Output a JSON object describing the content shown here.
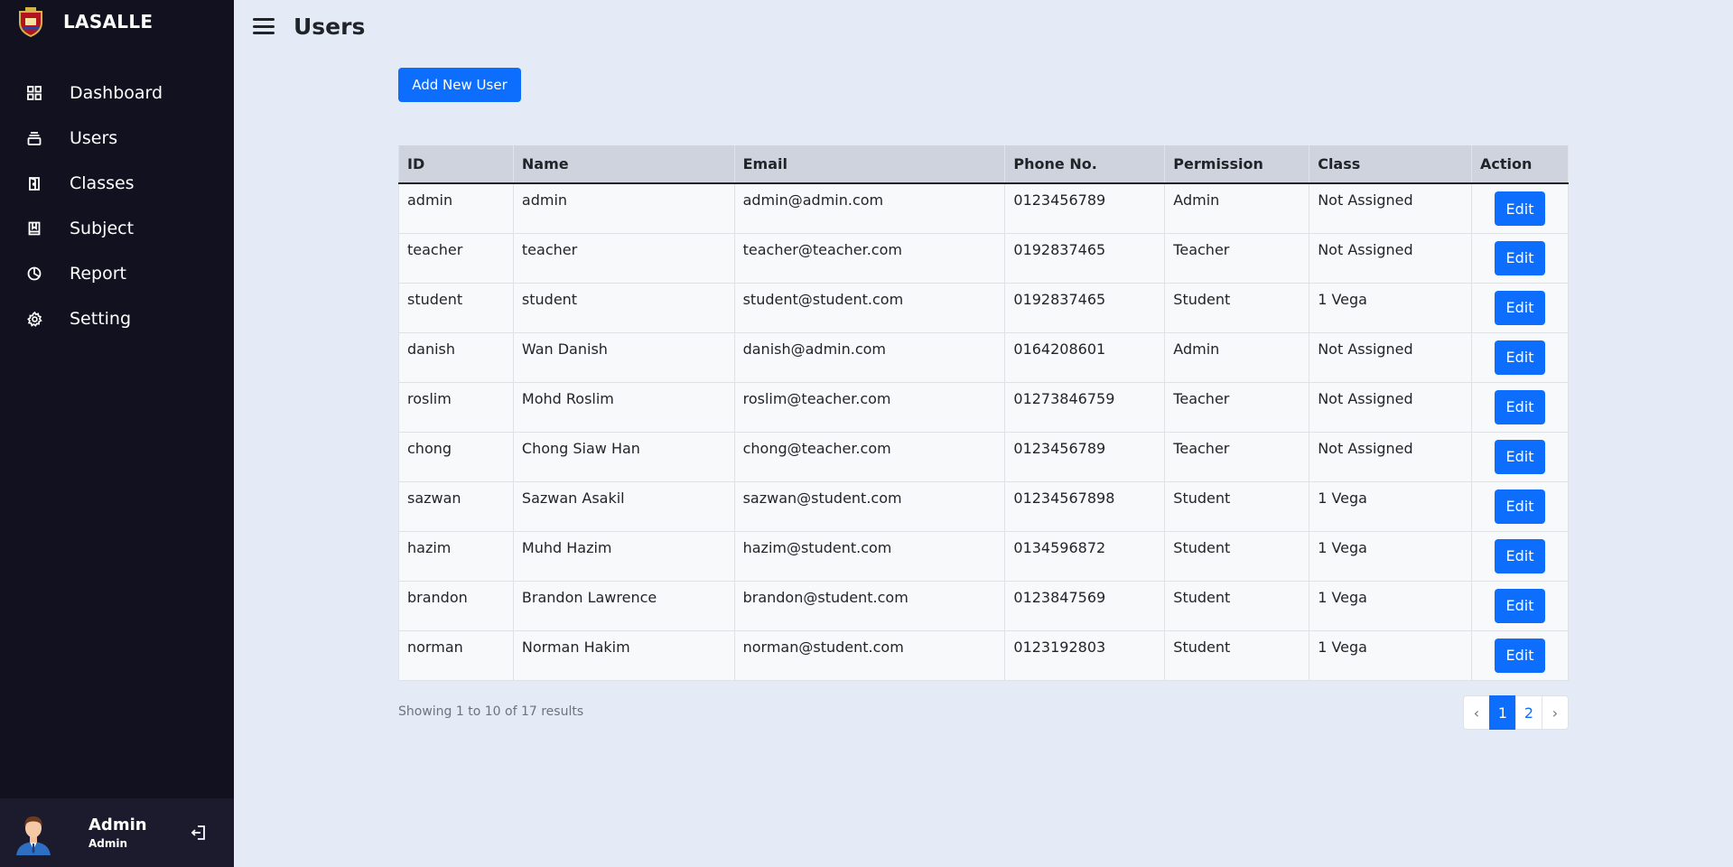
{
  "brand": {
    "name": "LASALLE"
  },
  "sidebar": {
    "items": [
      {
        "label": "Dashboard",
        "icon": "grid-icon"
      },
      {
        "label": "Users",
        "icon": "users-stack-icon"
      },
      {
        "label": "Classes",
        "icon": "door-icon"
      },
      {
        "label": "Subject",
        "icon": "book-icon"
      },
      {
        "label": "Report",
        "icon": "pie-chart-icon"
      },
      {
        "label": "Setting",
        "icon": "gear-icon"
      }
    ],
    "user": {
      "name": "Admin",
      "role": "Admin"
    }
  },
  "header": {
    "title": "Users"
  },
  "toolbar": {
    "add_label": "Add New User"
  },
  "table": {
    "columns": [
      "ID",
      "Name",
      "Email",
      "Phone No.",
      "Permission",
      "Class",
      "Action"
    ],
    "rows": [
      [
        "admin",
        "admin",
        "admin@admin.com",
        "0123456789",
        "Admin",
        "Not Assigned"
      ],
      [
        "teacher",
        "teacher",
        "teacher@teacher.com",
        "0192837465",
        "Teacher",
        "Not Assigned"
      ],
      [
        "student",
        "student",
        "student@student.com",
        "0192837465",
        "Student",
        "1 Vega"
      ],
      [
        "danish",
        "Wan Danish",
        "danish@admin.com",
        "0164208601",
        "Admin",
        "Not Assigned"
      ],
      [
        "roslim",
        "Mohd Roslim",
        "roslim@teacher.com",
        "01273846759",
        "Teacher",
        "Not Assigned"
      ],
      [
        "chong",
        "Chong Siaw Han",
        "chong@teacher.com",
        "0123456789",
        "Teacher",
        "Not Assigned"
      ],
      [
        "sazwan",
        "Sazwan Asakil",
        "sazwan@student.com",
        "01234567898",
        "Student",
        "1 Vega"
      ],
      [
        "hazim",
        "Muhd Hazim",
        "hazim@student.com",
        "0134596872",
        "Student",
        "1 Vega"
      ],
      [
        "brandon",
        "Brandon Lawrence",
        "brandon@student.com",
        "0123847569",
        "Student",
        "1 Vega"
      ],
      [
        "norman",
        "Norman Hakim",
        "norman@student.com",
        "0123192803",
        "Student",
        "1 Vega"
      ]
    ],
    "edit_label": "Edit"
  },
  "pagination": {
    "summary": "Showing 1 to 10 of 17 results",
    "prev": "‹",
    "next": "›",
    "pages": [
      "1",
      "2"
    ],
    "current": "1"
  },
  "colors": {
    "sidebar_bg": "#11111f",
    "page_bg": "#e4eaf6",
    "accent": "#0d6efd"
  }
}
